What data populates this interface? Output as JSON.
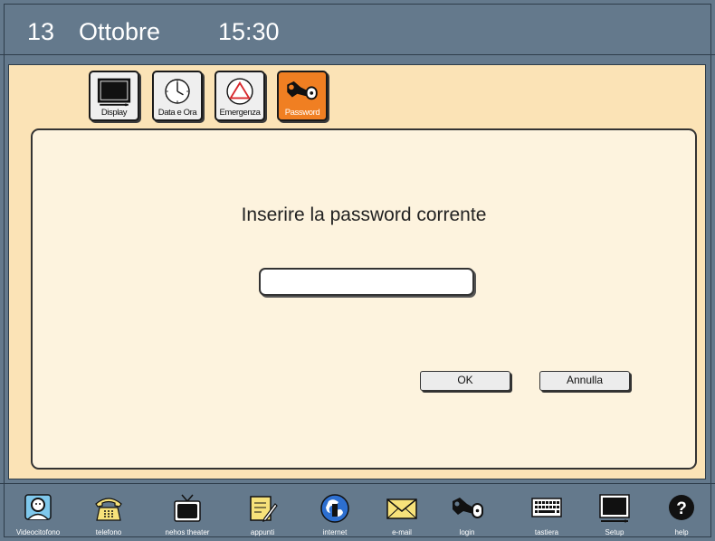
{
  "header": {
    "day": "13",
    "month": "Ottobre",
    "time": "15:30"
  },
  "tabs": [
    {
      "label": "Display",
      "icon": "monitor-icon"
    },
    {
      "label": "Data e Ora",
      "icon": "clock-icon"
    },
    {
      "label": "Emergenza",
      "icon": "warning-triangle-icon"
    },
    {
      "label": "Password",
      "icon": "key-icon",
      "active": true
    }
  ],
  "dialog": {
    "prompt": "Inserire la password corrente",
    "password_value": "",
    "ok_label": "OK",
    "cancel_label": "Annulla"
  },
  "dock": [
    {
      "label": "Videocitofono",
      "icon": "videophone-icon"
    },
    {
      "label": "telefono",
      "icon": "telephone-icon"
    },
    {
      "label": "nehos theater",
      "icon": "tv-icon"
    },
    {
      "label": "appunti",
      "icon": "notepad-icon"
    },
    {
      "label": "internet",
      "icon": "internet-globe-icon"
    },
    {
      "label": "e-mail",
      "icon": "envelope-icon"
    },
    {
      "label": "login",
      "icon": "key-icon"
    },
    {
      "label": "tastiera",
      "icon": "keyboard-icon"
    },
    {
      "label": "Setup",
      "icon": "monitor-icon"
    },
    {
      "label": "help",
      "icon": "help-icon"
    }
  ],
  "colors": {
    "background": "#64798c",
    "panel": "#fbe3b6",
    "content": "#fdf3de",
    "active_tab": "#f07f22"
  }
}
